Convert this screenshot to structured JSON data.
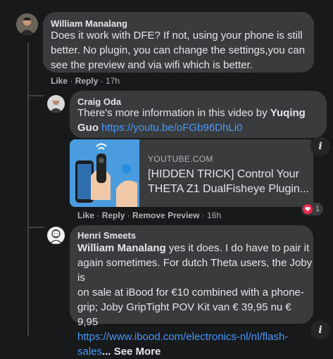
{
  "comments": [
    {
      "author": "William Manalang",
      "text_lines": [
        "Does it work with DFE? If not, using your phone is still",
        "better. No plugin, you can change the settings,you can",
        "see the preview and via wifi which is better."
      ],
      "actions": {
        "like": "Like",
        "reply": "Reply",
        "time": "17h",
        "sep": " · "
      }
    },
    {
      "author": "Craig Oda",
      "text_line1_prefix": "There's more information in this video by ",
      "text_line1_bold": "Yuqing",
      "text_line2_bold": "Guo",
      "link": "https://youtu.be/oFGb96DhLi0",
      "preview": {
        "domain": "YOUTUBE.COM",
        "title_lines": [
          "[HIDDEN TRICK] Control Your",
          "THETA Z1 DualFisheye Plugin..."
        ]
      },
      "actions": {
        "like": "Like",
        "reply": "Reply",
        "remove_preview": "Remove Preview",
        "time": "16h",
        "sep": " · "
      },
      "reaction_count": "1",
      "info_icon": "i"
    },
    {
      "author": "Henri Smeets",
      "mention": "William Manalang",
      "text_line1_rest": " yes it does. I do have to pair it",
      "text_lines": [
        "again sometimes. For dutch Theta users, the Joby is",
        "on sale at iBood for €10 combined with a phone-",
        "grip; Joby GripTight POV Kit van € 39,95 nu € 9,95"
      ],
      "link_line1": "https://www.ibood.com/electronics-nl/nl/flash-",
      "link_line2": "sales",
      "see_more": "... See More",
      "info_icon": "i"
    }
  ],
  "colors": {
    "background": "#18191a",
    "bubble": "#3a3b3c",
    "text": "#e4e6eb",
    "muted": "#b0b3b8",
    "link": "#4599ff",
    "heart": "#f0284a"
  },
  "icons": {
    "info": "info-icon",
    "heart": "heart-reaction-icon"
  }
}
